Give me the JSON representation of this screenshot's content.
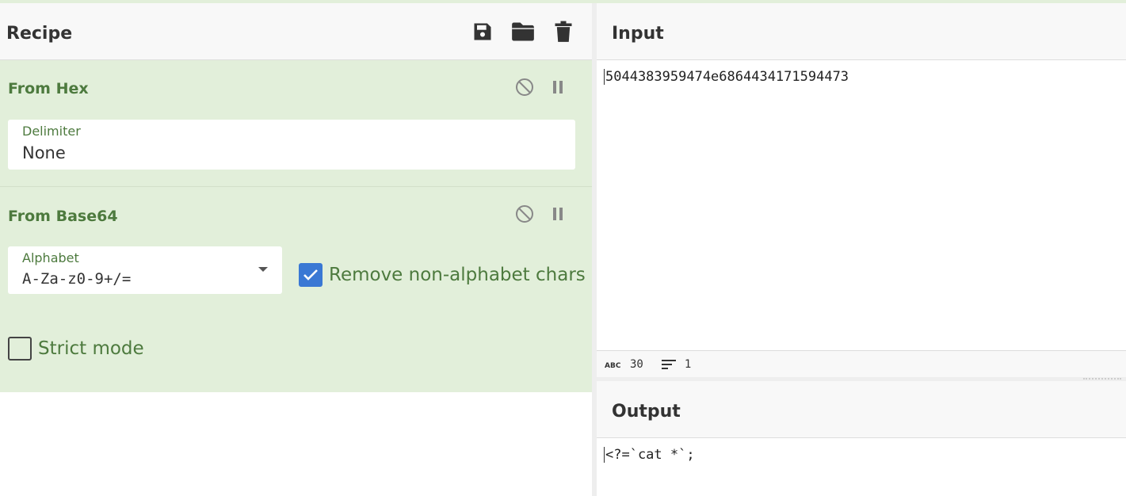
{
  "recipe": {
    "title": "Recipe",
    "icons": [
      "save-icon",
      "folder-icon",
      "trash-icon"
    ],
    "operations": [
      {
        "name": "From Hex",
        "controls": [
          "disable-icon",
          "pause-icon"
        ],
        "delimiter": {
          "label": "Delimiter",
          "value": "None"
        }
      },
      {
        "name": "From Base64",
        "controls": [
          "disable-icon",
          "pause-icon"
        ],
        "alphabet": {
          "label": "Alphabet",
          "value": "A-Za-z0-9+/="
        },
        "remove_non_alphabet": {
          "label": "Remove non-alphabet chars",
          "checked": true
        },
        "strict_mode": {
          "label": "Strict mode",
          "checked": false
        }
      }
    ]
  },
  "input": {
    "title": "Input",
    "text": "5044383959474e6864434171594473",
    "status": {
      "length": "30",
      "lines": "1"
    }
  },
  "output": {
    "title": "Output",
    "text": "<?=`cat *`;"
  },
  "colors": {
    "operation_bg": "#e2efda",
    "operation_text": "#4d7a3e",
    "checkbox_accent": "#3a78d4"
  }
}
